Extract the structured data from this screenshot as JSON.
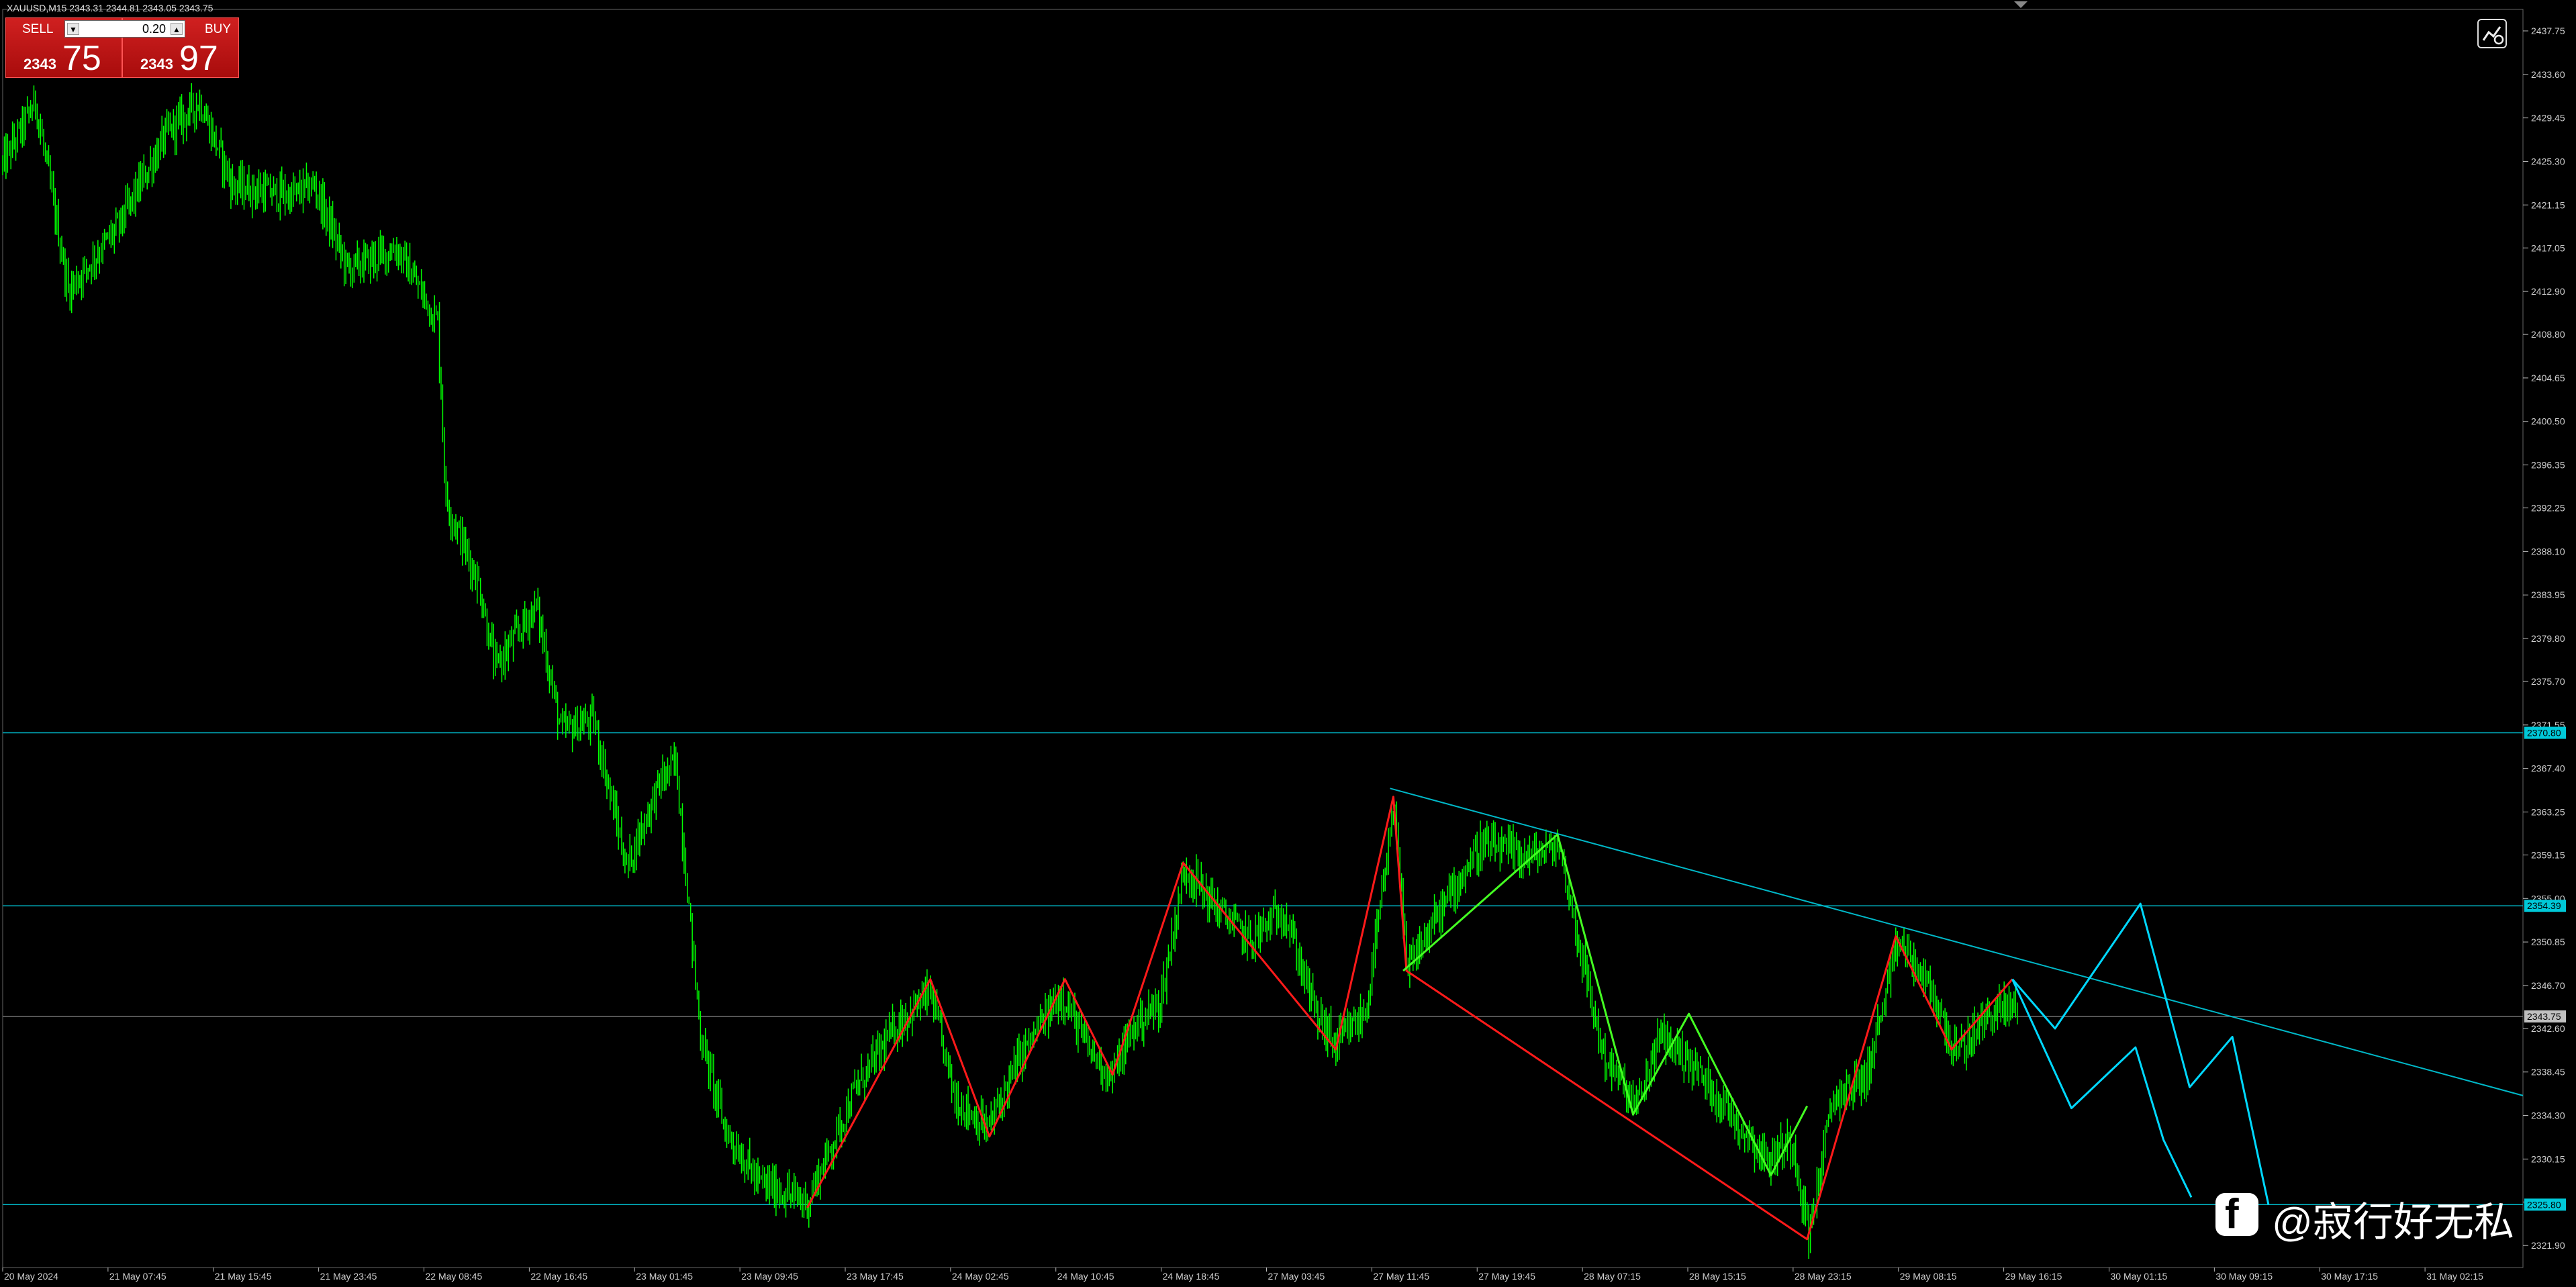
{
  "header": {
    "symbol_info": "XAUUSD,M15  2343.31 2344.81 2343.05 2343.75"
  },
  "trade_panel": {
    "sell_label": "SELL",
    "buy_label": "BUY",
    "lot_value": "0.20",
    "sell_price_small": "2343",
    "sell_price_big": "75",
    "buy_price_small": "2343",
    "buy_price_big": "97",
    "lot_down_icon": "down-arrow",
    "lot_up_icon": "up-arrow"
  },
  "settings_icon": "chart-settings-icon",
  "watermark": {
    "icon": "facebook-icon",
    "text": "@寂行好无私"
  },
  "colors": {
    "candle": "#00ff00",
    "grid_line": "#333333",
    "hline": "#00b8c8",
    "trend_line": "#00b8c8",
    "zigzag_red": "#ff1a1a",
    "zigzag_green": "#44ff22",
    "projection": "#00d8ff",
    "price_tag_bg": "#00c8d8"
  },
  "chart_data": {
    "type": "candlestick",
    "symbol": "XAUUSD",
    "timeframe": "M15",
    "ylim": [
      2319.8,
      2439.8
    ],
    "price_ticks": [
      "2437.75",
      "2433.60",
      "2429.45",
      "2425.30",
      "2421.15",
      "2417.05",
      "2412.90",
      "2408.80",
      "2404.65",
      "2400.50",
      "2396.35",
      "2392.25",
      "2388.10",
      "2383.95",
      "2379.80",
      "2375.70",
      "2371.55",
      "2367.40",
      "2363.25",
      "2359.15",
      "2355.00",
      "2350.85",
      "2346.70",
      "2342.60",
      "2338.45",
      "2334.30",
      "2330.15",
      "2326.05",
      "2321.90"
    ],
    "time_ticks": [
      "20 May 2024",
      "21 May 07:45",
      "21 May 15:45",
      "21 May 23:45",
      "22 May 08:45",
      "22 May 16:45",
      "23 May 01:45",
      "23 May 09:45",
      "23 May 17:45",
      "24 May 02:45",
      "24 May 10:45",
      "24 May 18:45",
      "27 May 03:45",
      "27 May 11:45",
      "27 May 19:45",
      "28 May 07:15",
      "28 May 15:15",
      "28 May 23:15",
      "29 May 08:15",
      "29 May 16:15",
      "30 May 01:15",
      "30 May 09:15",
      "30 May 17:15",
      "31 May 02:15"
    ],
    "price_path": [
      [
        0,
        2425
      ],
      [
        20,
        2431
      ],
      [
        40,
        2413
      ],
      [
        70,
        2419
      ],
      [
        100,
        2428
      ],
      [
        120,
        2431
      ],
      [
        140,
        2423
      ],
      [
        175,
        2422
      ],
      [
        190,
        2423
      ],
      [
        210,
        2415
      ],
      [
        240,
        2417
      ],
      [
        265,
        2410
      ],
      [
        270,
        2393
      ],
      [
        290,
        2385
      ],
      [
        300,
        2377
      ],
      [
        325,
        2383
      ],
      [
        340,
        2371
      ],
      [
        360,
        2372
      ],
      [
        380,
        2358
      ],
      [
        400,
        2366
      ],
      [
        410,
        2368
      ],
      [
        425,
        2342
      ],
      [
        440,
        2333
      ],
      [
        460,
        2328
      ],
      [
        490,
        2326
      ],
      [
        520,
        2337
      ],
      [
        545,
        2343
      ],
      [
        565,
        2346
      ],
      [
        580,
        2336
      ],
      [
        600,
        2333
      ],
      [
        620,
        2340
      ],
      [
        645,
        2346
      ],
      [
        660,
        2341
      ],
      [
        675,
        2338
      ],
      [
        690,
        2343
      ],
      [
        705,
        2345
      ],
      [
        720,
        2358
      ],
      [
        740,
        2354
      ],
      [
        760,
        2351
      ],
      [
        780,
        2354
      ],
      [
        800,
        2344
      ],
      [
        812,
        2341
      ],
      [
        830,
        2344
      ],
      [
        848,
        2364
      ],
      [
        855,
        2348
      ],
      [
        880,
        2355
      ],
      [
        900,
        2360
      ],
      [
        930,
        2359
      ],
      [
        948,
        2360
      ],
      [
        965,
        2347
      ],
      [
        975,
        2340
      ],
      [
        995,
        2335
      ],
      [
        1010,
        2342
      ],
      [
        1030,
        2339
      ],
      [
        1050,
        2335
      ],
      [
        1075,
        2330
      ],
      [
        1090,
        2332
      ],
      [
        1100,
        2323
      ],
      [
        1115,
        2336
      ],
      [
        1135,
        2338
      ],
      [
        1155,
        2351
      ],
      [
        1175,
        2346
      ],
      [
        1190,
        2340
      ],
      [
        1210,
        2344
      ],
      [
        1227,
        2345
      ]
    ],
    "last_index": 1227,
    "index_max": 1535,
    "horizontal_levels": [
      {
        "price": 2370.8,
        "label": "2370.80"
      },
      {
        "price": 2354.3,
        "label": "2354.39"
      },
      {
        "price": 2343.75,
        "label": "2343.75"
      },
      {
        "price": 2325.8,
        "label": "2325.80"
      }
    ],
    "trend_line": [
      [
        845,
        2365.5
      ],
      [
        1535,
        2336.2
      ]
    ],
    "zigzag_red": [
      [
        490,
        2325.5
      ],
      [
        565,
        2347.3
      ],
      [
        601,
        2332.3
      ],
      [
        647,
        2347.3
      ],
      [
        676,
        2338.2
      ],
      [
        719,
        2358.4
      ],
      [
        812,
        2340.6
      ],
      [
        847,
        2364.7
      ],
      [
        855,
        2348.1
      ],
      [
        1099,
        2322.5
      ],
      [
        1153,
        2351.4
      ],
      [
        1187,
        2340.6
      ],
      [
        1224,
        2347.3
      ]
    ],
    "zigzag_green": [
      [
        853,
        2348.1
      ],
      [
        947,
        2361.1
      ],
      [
        993,
        2334.4
      ],
      [
        1027,
        2344.0
      ],
      [
        1077,
        2328.6
      ],
      [
        1099,
        2335.2
      ]
    ],
    "projection_lines": [
      [
        [
          1224,
          2347.3
        ],
        [
          1250,
          2342.6
        ],
        [
          1302,
          2354.5
        ],
        [
          1332,
          2337.0
        ],
        [
          1358,
          2341.8
        ],
        [
          1380,
          2325.8
        ]
      ],
      [
        [
          1224,
          2347.3
        ],
        [
          1260,
          2335.0
        ],
        [
          1299,
          2340.8
        ],
        [
          1316,
          2332.0
        ],
        [
          1333,
          2326.5
        ]
      ]
    ]
  }
}
